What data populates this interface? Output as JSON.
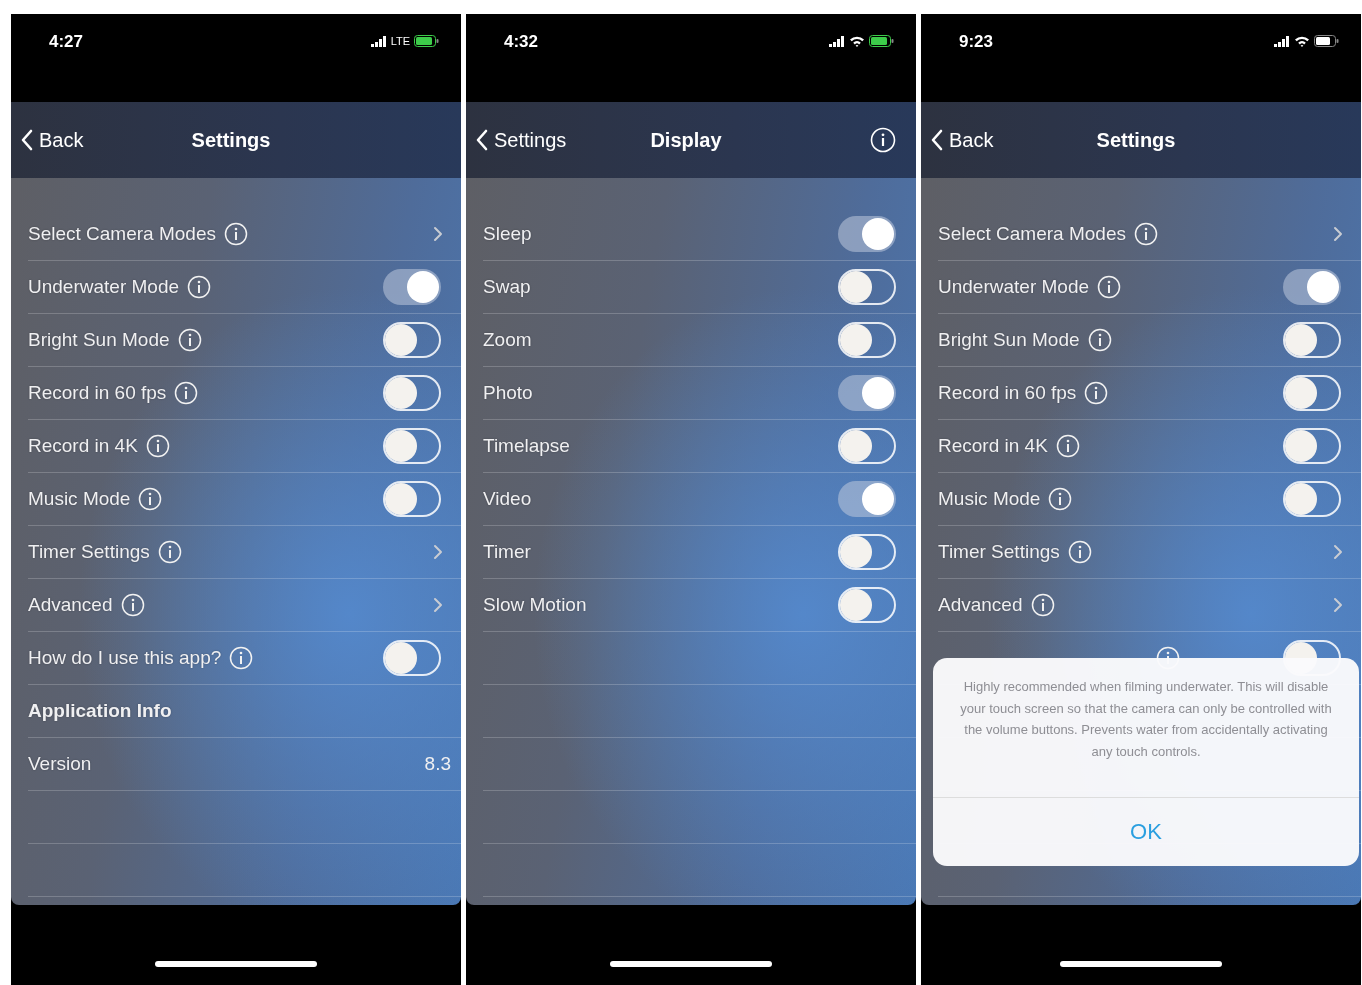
{
  "phones": [
    {
      "status_bar": {
        "time": "4:27",
        "network": {
          "kind": "lte",
          "label": "LTE"
        },
        "battery_charging": true
      },
      "nav": {
        "back": "Back",
        "title": "Settings",
        "info_button": false
      },
      "rows": [
        {
          "kind": "link",
          "label": "Select Camera Modes",
          "info": true
        },
        {
          "kind": "toggle",
          "label": "Underwater Mode",
          "info": true,
          "on": true
        },
        {
          "kind": "toggle",
          "label": "Bright Sun Mode",
          "info": true,
          "on": false
        },
        {
          "kind": "toggle",
          "label": "Record in 60 fps",
          "info": true,
          "on": false
        },
        {
          "kind": "toggle",
          "label": "Record in 4K",
          "info": true,
          "on": false
        },
        {
          "kind": "toggle",
          "label": "Music Mode",
          "info": true,
          "on": false
        },
        {
          "kind": "link",
          "label": "Timer Settings",
          "info": true
        },
        {
          "kind": "link",
          "label": "Advanced",
          "info": true
        },
        {
          "kind": "toggle",
          "label": "How do I use this app?",
          "info": true,
          "on": false
        },
        {
          "kind": "header",
          "label": "Application Info"
        },
        {
          "kind": "value",
          "label": "Version",
          "value": "8.3"
        }
      ]
    },
    {
      "status_bar": {
        "time": "4:32",
        "network": {
          "kind": "wifi"
        },
        "battery_charging": true
      },
      "nav": {
        "back": "Settings",
        "title": "Display",
        "info_button": true
      },
      "rows": [
        {
          "kind": "toggle",
          "label": "Sleep",
          "info": false,
          "on": true
        },
        {
          "kind": "toggle",
          "label": "Swap",
          "info": false,
          "on": false
        },
        {
          "kind": "toggle",
          "label": "Zoom",
          "info": false,
          "on": false
        },
        {
          "kind": "toggle",
          "label": "Photo",
          "info": false,
          "on": true
        },
        {
          "kind": "toggle",
          "label": "Timelapse",
          "info": false,
          "on": false
        },
        {
          "kind": "toggle",
          "label": "Video",
          "info": false,
          "on": true
        },
        {
          "kind": "toggle",
          "label": "Timer",
          "info": false,
          "on": false
        },
        {
          "kind": "toggle",
          "label": "Slow Motion",
          "info": false,
          "on": false
        }
      ]
    },
    {
      "status_bar": {
        "time": "9:23",
        "network": {
          "kind": "wifi"
        },
        "battery_charging": false
      },
      "nav": {
        "back": "Back",
        "title": "Settings",
        "info_button": false
      },
      "rows": [
        {
          "kind": "link",
          "label": "Select Camera Modes",
          "info": true
        },
        {
          "kind": "toggle",
          "label": "Underwater Mode",
          "info": true,
          "on": true
        },
        {
          "kind": "toggle",
          "label": "Bright Sun Mode",
          "info": true,
          "on": false
        },
        {
          "kind": "toggle",
          "label": "Record in 60 fps",
          "info": true,
          "on": false
        },
        {
          "kind": "toggle",
          "label": "Record in 4K",
          "info": true,
          "on": false
        },
        {
          "kind": "toggle",
          "label": "Music Mode",
          "info": true,
          "on": false
        },
        {
          "kind": "link",
          "label": "Timer Settings",
          "info": true
        },
        {
          "kind": "link",
          "label": "Advanced",
          "info": true
        },
        {
          "kind": "toggle",
          "info": true,
          "on": false
        }
      ],
      "alert": {
        "message": "Highly recommended when filming underwater. This will disable your touch screen so that the camera can only be controlled with the volume buttons. Prevents water from accidentally activating any touch controls.",
        "button": "OK"
      }
    }
  ]
}
